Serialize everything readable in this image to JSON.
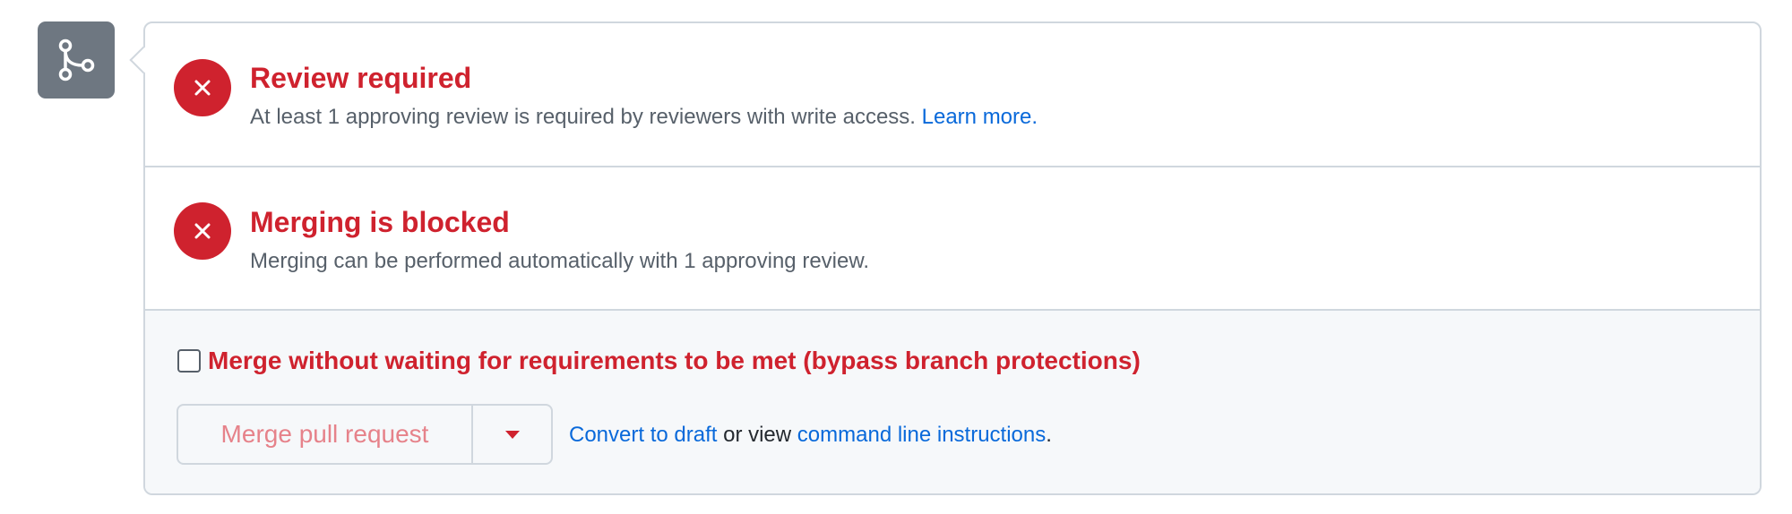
{
  "review": {
    "title": "Review required",
    "description": "At least 1 approving review is required by reviewers with write access.",
    "link": "Learn more."
  },
  "merging": {
    "title": "Merging is blocked",
    "description": "Merging can be performed automatically with 1 approving review."
  },
  "bypass": {
    "label": "Merge without waiting for requirements to be met (bypass branch protections)",
    "checked": false
  },
  "merge": {
    "button_label": "Merge pull request",
    "convert_link": "Convert to draft",
    "or_view_text": "or view",
    "cli_link": "command line instructions",
    "period": "."
  },
  "icons": {
    "merge": "git-merge-icon",
    "error": "x-circle-icon",
    "dropdown": "triangle-down-icon"
  },
  "colors": {
    "danger": "#cf222e",
    "link": "#0969da",
    "muted": "#57606a",
    "icon_tile": "#6e7781"
  }
}
